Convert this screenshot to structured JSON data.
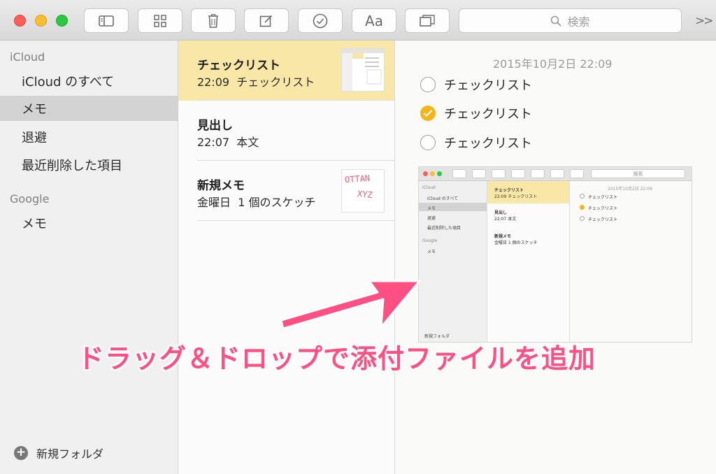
{
  "toolbar": {
    "search_placeholder": "検索",
    "font_button_label": "Aa",
    "overflow_label": ">>"
  },
  "sidebar": {
    "sections": [
      {
        "header": "iCloud",
        "items": [
          "iCloud のすべて",
          "メモ",
          "退避",
          "最近削除した項目"
        ]
      },
      {
        "header": "Google",
        "items": [
          "メモ"
        ]
      }
    ],
    "selected_item": "メモ",
    "new_folder_label": "新規フォルダ"
  },
  "notes_list": [
    {
      "title": "チェックリスト",
      "time": "22:09",
      "preview": "チェックリスト",
      "selected": true
    },
    {
      "title": "見出し",
      "time": "22:07",
      "preview": "本文",
      "selected": false
    },
    {
      "title": "新規メモ",
      "time": "金曜日",
      "preview": "1 個のスケッチ",
      "selected": false,
      "sketch_text": [
        "OTTAN",
        "XYZ"
      ]
    }
  ],
  "editor": {
    "date": "2015年10月2日 22:09",
    "checklist": [
      {
        "label": "チェックリスト",
        "checked": false
      },
      {
        "label": "チェックリスト",
        "checked": true
      },
      {
        "label": "チェックリスト",
        "checked": false
      }
    ]
  },
  "embedded_screenshot": {
    "search": "検索",
    "sidebar": [
      "iCloud",
      "iCloud のすべて",
      "メモ",
      "退避",
      "最近削除した項目",
      "Google",
      "メモ"
    ],
    "notes": [
      {
        "title": "チェックリスト",
        "sub": "22:09 チェックリスト"
      },
      {
        "title": "見出し",
        "sub": "22:07 本文"
      },
      {
        "title": "新規メモ",
        "sub": "金曜日 1 個のスケッチ"
      }
    ],
    "date": "2015年10月2日 22:09",
    "checklist": [
      "チェックリスト",
      "チェックリスト",
      "チェックリスト"
    ],
    "new_folder": "新規フォルダ"
  },
  "annotation": {
    "callout_text": "ドラッグ＆ドロップで添付ファイルを追加",
    "color": "#ff4f83"
  },
  "colors": {
    "selected_note": "#f8e7a6",
    "check_on": "#f5b418",
    "sidebar_selected": "#d4d3d4"
  }
}
